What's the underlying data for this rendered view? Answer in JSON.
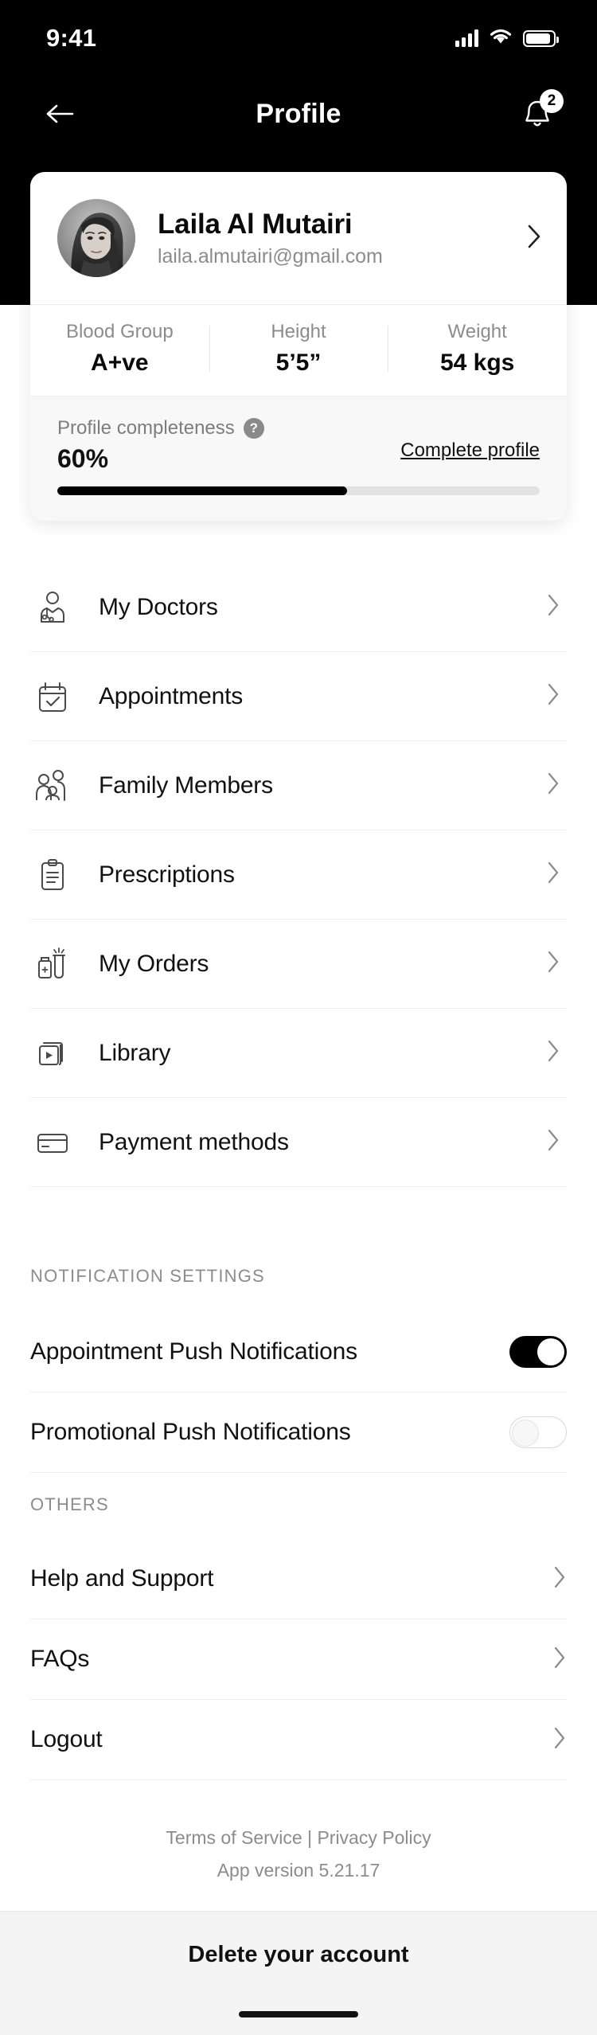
{
  "status_bar": {
    "time": "9:41",
    "signal_icon": "cellular-signal-icon",
    "wifi_icon": "wifi-icon",
    "battery_icon": "battery-icon"
  },
  "header": {
    "title": "Profile",
    "back_icon": "back-arrow-icon",
    "notification_icon": "bell-icon",
    "notification_badge": "2"
  },
  "profile": {
    "name": "Laila Al Mutairi",
    "email": "laila.almutairi@gmail.com",
    "avatar_alt": "user-avatar",
    "chevron_icon": "chevron-right-icon",
    "stats": [
      {
        "label": "Blood Group",
        "value": "A+ve"
      },
      {
        "label": "Height",
        "value": "5’5”"
      },
      {
        "label": "Weight",
        "value": "54 kgs"
      }
    ],
    "completeness": {
      "label": "Profile completeness",
      "help_icon": "question-mark-icon",
      "percent_text": "60%",
      "percent_value": 60,
      "cta_label": "Complete profile",
      "bar_color": "#000000",
      "track_color": "#e2e2e2"
    }
  },
  "menu": {
    "items": [
      {
        "label": "My Doctors",
        "icon": "doctor-icon"
      },
      {
        "label": "Appointments",
        "icon": "calendar-check-icon"
      },
      {
        "label": "Family Members",
        "icon": "family-members-icon"
      },
      {
        "label": "Prescriptions",
        "icon": "clipboard-icon"
      },
      {
        "label": "My Orders",
        "icon": "medicine-vial-icon"
      },
      {
        "label": "Library",
        "icon": "video-library-icon"
      },
      {
        "label": "Payment methods",
        "icon": "credit-card-icon"
      }
    ]
  },
  "notification_settings": {
    "title": "NOTIFICATION SETTINGS",
    "rows": [
      {
        "label": "Appointment Push Notifications",
        "state": "on"
      },
      {
        "label": "Promotional Push Notifications",
        "state": "off"
      }
    ]
  },
  "others": {
    "title": "OTHERS",
    "rows": [
      {
        "label": "Help and Support"
      },
      {
        "label": "FAQs"
      },
      {
        "label": "Logout"
      }
    ]
  },
  "footer": {
    "terms_label": "Terms of Service",
    "separator": " | ",
    "privacy_label": "Privacy Policy",
    "version": "App version 5.21.17",
    "delete_label": "Delete your account"
  }
}
